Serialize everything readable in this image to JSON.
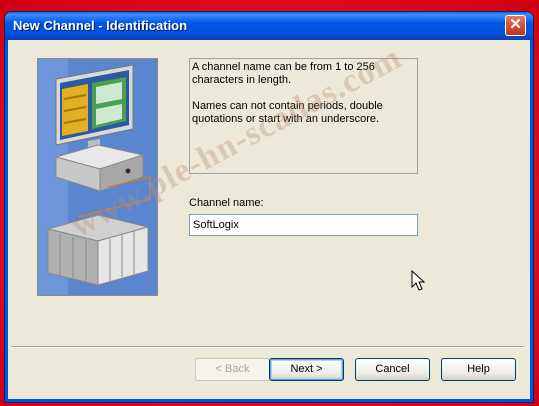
{
  "window": {
    "title": "New Channel - Identification",
    "close_glyph": "✕"
  },
  "info": {
    "line1": "A channel name can be from 1 to 256 characters in length.",
    "line2": "Names can not contain periods, double quotations or start with an underscore."
  },
  "channel": {
    "label": "Channel name:",
    "value": "SoftLogix"
  },
  "buttons": {
    "back": "< Back",
    "next": "Next >",
    "cancel": "Cancel",
    "help": "Help"
  },
  "watermark": "www.ple-hn-scadas.com",
  "icons": {
    "illustration": "computer-and-plc-illustration",
    "cursor": "mouse-pointer-icon",
    "close": "close-icon"
  },
  "colors": {
    "titlebar": "#0054e3",
    "window_bg": "#ece9d8",
    "outer_bg": "#e8101e"
  }
}
